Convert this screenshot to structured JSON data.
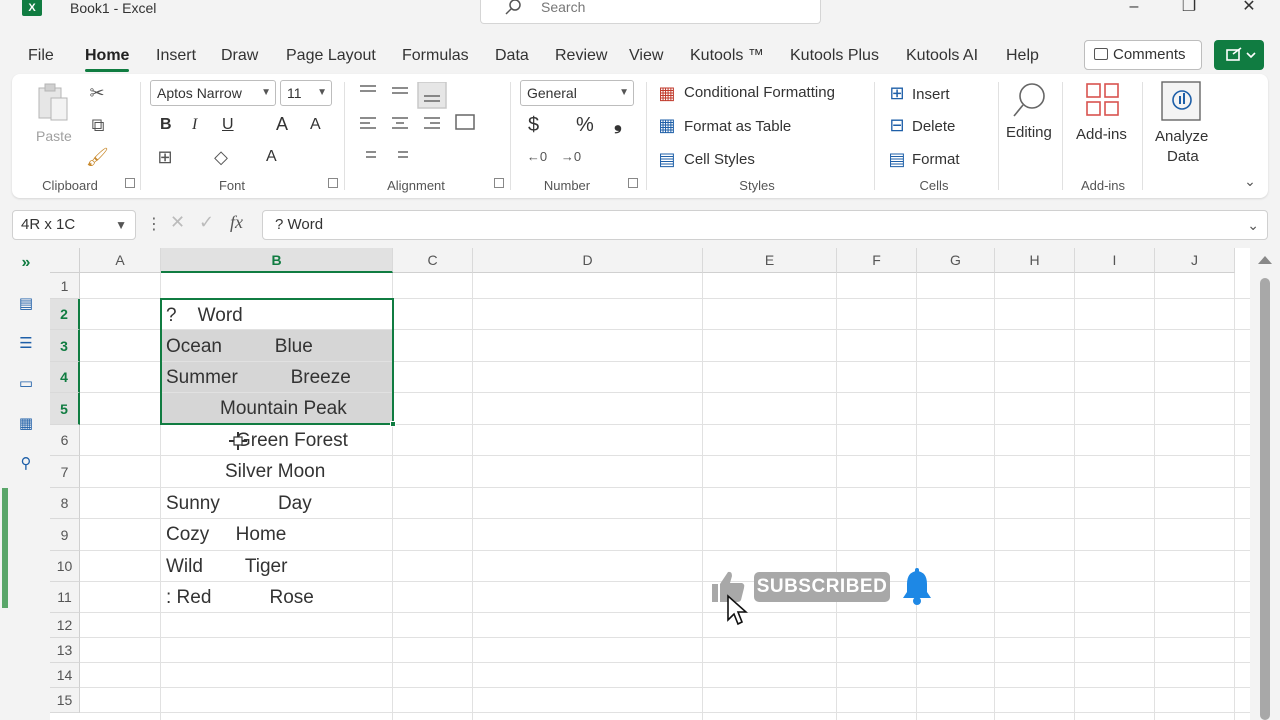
{
  "window": {
    "title": "Book1  -  Excel",
    "app_letter": "X"
  },
  "search": {
    "placeholder": "Search"
  },
  "window_controls": {
    "minimize": "–",
    "restore": "❐",
    "close": "✕"
  },
  "menu": {
    "items": [
      "File",
      "Home",
      "Insert",
      "Draw",
      "Page Layout",
      "Formulas",
      "Data",
      "Review",
      "View",
      "Kutools ™",
      "Kutools Plus",
      "Kutools AI",
      "Help"
    ],
    "active": "Home",
    "comments_label": "Comments"
  },
  "ribbon": {
    "clipboard": {
      "label": "Clipboard",
      "paste": "Paste"
    },
    "font": {
      "label": "Font",
      "font_name": "Aptos Narrow",
      "font_size": "11",
      "bold": "B",
      "italic": "I",
      "underline": "U",
      "grow": "A",
      "shrink": "A",
      "color_a": "A"
    },
    "alignment": {
      "label": "Alignment"
    },
    "number": {
      "label": "Number",
      "format": "General",
      "currency": "$",
      "percent": "%",
      "comma": "❟"
    },
    "styles": {
      "label": "Styles",
      "conditional": "Conditional Formatting",
      "format_table": "Format as Table",
      "cell_styles": "Cell Styles"
    },
    "cells": {
      "label": "Cells",
      "insert": "Insert",
      "delete": "Delete",
      "format": "Format"
    },
    "editing": {
      "label": "Editing"
    },
    "addins": {
      "label": "Add-ins",
      "button": "Add-ins"
    },
    "analyze": {
      "line1": "Analyze",
      "line2": "Data"
    }
  },
  "formula_bar": {
    "name_box": "4R x 1C",
    "fx": "fx",
    "content": "?   Word"
  },
  "columns": [
    "A",
    "B",
    "C",
    "D",
    "E",
    "F",
    "G",
    "H",
    "I",
    "J"
  ],
  "rows": [
    "1",
    "2",
    "3",
    "4",
    "5",
    "6",
    "7",
    "8",
    "9",
    "10",
    "11",
    "12",
    "13",
    "14",
    "15"
  ],
  "cells": {
    "b2": "?    Word",
    "b3": "Ocean          Blue",
    "b4": "Summer          Breeze",
    "b5": "Mountain Peak",
    "b6": "Green Forest",
    "b7": "Silver Moon",
    "b8": "Sunny           Day",
    "b9": "Cozy     Home",
    "b10": "Wild        Tiger",
    "b11": ": Red           Rose"
  },
  "overlay": {
    "subscribed": "SUBSCRIBED"
  },
  "colors": {
    "accent": "#107c41",
    "selection": "#d6d6d6",
    "bell": "#1e88e5"
  }
}
